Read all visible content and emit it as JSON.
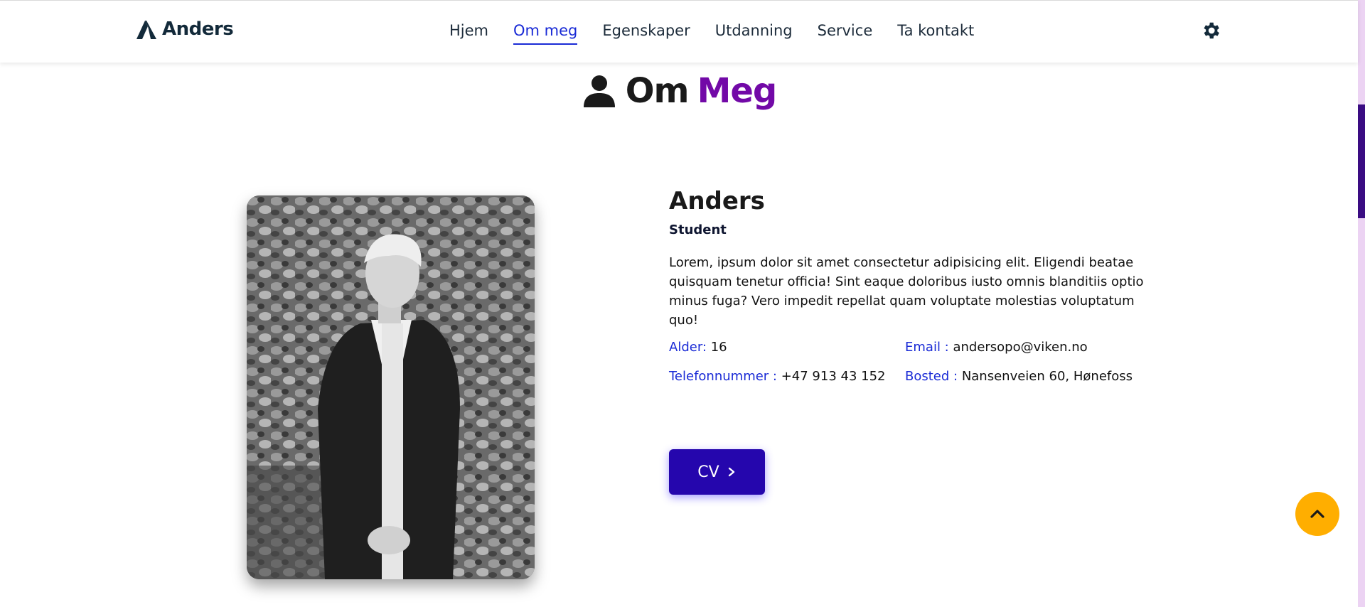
{
  "header": {
    "brand": "Anders",
    "nav": [
      "Hjem",
      "Om meg",
      "Egenskaper",
      "Utdanning",
      "Service",
      "Ta kontakt"
    ],
    "active_nav": "Om meg"
  },
  "section": {
    "title_part1": "Om",
    "title_part2": "Meg"
  },
  "profile": {
    "name": "Anders",
    "role": "Student",
    "bio": "Lorem, ipsum dolor sit amet consectetur adipisicing elit. Eligendi beatae quisquam tenetur officia! Sint eaque doloribus iusto omnis blanditiis optio minus fuga? Vero impedit repellat quam voluptate molestias voluptatum quo!",
    "details": {
      "age_label": "Alder:",
      "age_value": " 16",
      "email_label": "Email :",
      "email_value": " andersopo@viken.no",
      "phone_label": "Telefonnummer :",
      "phone_value": " +47 913 43 152",
      "place_label": "Bosted :",
      "place_value": " Nansenveien 60, Hønefoss"
    },
    "cv_button": "CV"
  },
  "icons": {
    "brand": "mountain-logo-icon",
    "settings": "gear-icon",
    "section": "user-icon",
    "cv": "chevron-right-icon",
    "scroll_top": "chevron-up-icon"
  },
  "colors": {
    "accent_blue": "#1a2bd6",
    "accent_purple": "#7209a7",
    "button_bg": "#2506ad",
    "scroll_top_bg": "#ffae00"
  }
}
